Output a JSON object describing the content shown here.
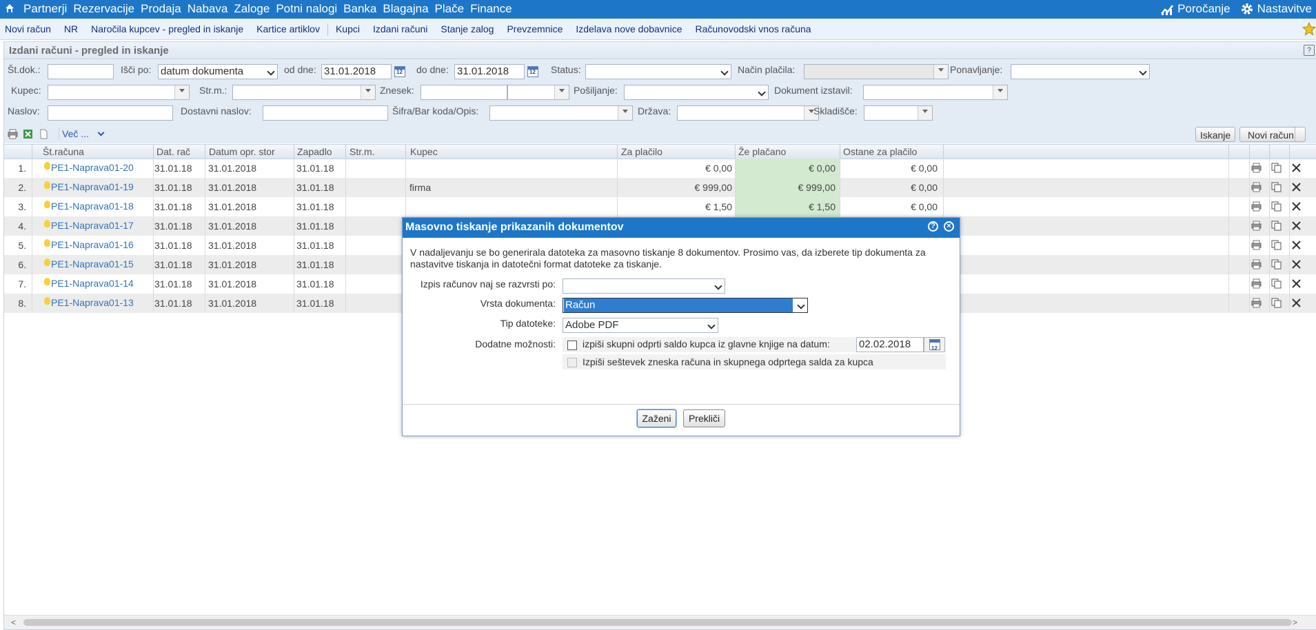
{
  "top_menu": {
    "items": [
      "Partnerji",
      "Rezervacije",
      "Prodaja",
      "Nabava",
      "Zaloge",
      "Potni nalogi",
      "Banka",
      "Blagajna",
      "Plače",
      "Finance"
    ],
    "reports_label": "Poročanje",
    "settings_label": "Nastavitve"
  },
  "sub_menu": {
    "items": [
      "Novi račun",
      "NR",
      "Naročila kupcev - pregled in iskanje",
      "Kartice artiklov",
      "Kupci",
      "Izdani računi",
      "Stanje zalog",
      "Prevzemnice",
      "Izdelava nove dobavnice",
      "Računovodski vnos računa"
    ]
  },
  "panel": {
    "title": "Izdani računi - pregled in iskanje",
    "help_label": "?"
  },
  "filters": {
    "st_dok_label": "Št.dok.:",
    "isci_po_label": "Išči po:",
    "isci_po_value": "datum dokumenta",
    "od_dne_label": "od dne:",
    "od_dne_value": "31.01.2018",
    "do_dne_label": "do dne:",
    "do_dne_value": "31.01.2018",
    "status_label": "Status:",
    "nacin_placila_label": "Način plačila:",
    "ponavljanje_label": "Ponavljanje:",
    "kupec_label": "Kupec:",
    "strm_label": "Str.m.:",
    "znesek_label": "Znesek:",
    "posiljanje_label": "Pošiljanje:",
    "dokument_izstavil_label": "Dokument izstavil:",
    "naslov_label": "Naslov:",
    "dostavni_naslov_label": "Dostavni naslov:",
    "sifra_label": "Šifra/Bar koda/Opis:",
    "drzava_label": "Država:",
    "skladisce_label": "Skladišče:"
  },
  "toolbar": {
    "vec_label": "Več ...",
    "search_button": "Iskanje",
    "new_invoice_button": "Novi račun"
  },
  "grid": {
    "columns": [
      "Št.računa",
      "Dat. rač",
      "Datum opr. stor",
      "Zapadlo",
      "Str.m.",
      "Kupec",
      "Za plačilo",
      "Že plačano",
      "Ostane za plačilo"
    ],
    "rows": [
      {
        "n": "1.",
        "st": "PE1-Naprava01-20",
        "dat": "31.01.18",
        "opr": "31.01.2018",
        "zap": "31.01.18",
        "kupec": "",
        "za": "€ 0,00",
        "ze": "€ 0,00",
        "ost": "€ 0,00"
      },
      {
        "n": "2.",
        "st": "PE1-Naprava01-19",
        "dat": "31.01.18",
        "opr": "31.01.2018",
        "zap": "31.01.18",
        "kupec": "firma",
        "za": "€ 999,00",
        "ze": "€ 999,00",
        "ost": "€ 0,00"
      },
      {
        "n": "3.",
        "st": "PE1-Naprava01-18",
        "dat": "31.01.18",
        "opr": "31.01.2018",
        "zap": "31.01.18",
        "kupec": "",
        "za": "€ 1,50",
        "ze": "€ 1,50",
        "ost": "€ 0,00"
      },
      {
        "n": "4.",
        "st": "PE1-Naprava01-17",
        "dat": "31.01.18",
        "opr": "31.01.2018",
        "zap": "31.01.18",
        "kupec": "",
        "za": "",
        "ze": "",
        "ost": ""
      },
      {
        "n": "5.",
        "st": "PE1-Naprava01-16",
        "dat": "31.01.18",
        "opr": "31.01.2018",
        "zap": "31.01.18",
        "kupec": "",
        "za": "",
        "ze": "",
        "ost": ""
      },
      {
        "n": "6.",
        "st": "PE1-Naprava01-15",
        "dat": "31.01.18",
        "opr": "31.01.2018",
        "zap": "31.01.18",
        "kupec": "",
        "za": "",
        "ze": "",
        "ost": ""
      },
      {
        "n": "7.",
        "st": "PE1-Naprava01-14",
        "dat": "31.01.18",
        "opr": "31.01.2018",
        "zap": "31.01.18",
        "kupec": "",
        "za": "",
        "ze": "",
        "ost": ""
      },
      {
        "n": "8.",
        "st": "PE1-Naprava01-13",
        "dat": "31.01.18",
        "opr": "31.01.2018",
        "zap": "31.01.18",
        "kupec": "",
        "za": "",
        "ze": "",
        "ost": ""
      }
    ]
  },
  "dialog": {
    "title": "Masovno tiskanje prikazanih dokumentov",
    "help_label": "?",
    "close_label": "×",
    "description": "V nadaljevanju se bo generirala datoteka za masovno tiskanje 8 dokumentov. Prosimo vas, da izberete tip dokumenta za nastavitve tiskanja in datotečni format datoteke za tiskanje.",
    "sort_label": "Izpis računov naj se razvrsti po:",
    "sort_value": "",
    "doc_type_label": "Vrsta dokumenta:",
    "doc_type_value": "Račun",
    "file_type_label": "Tip datoteke:",
    "file_type_value": "Adobe PDF",
    "extra_label": "Dodatne možnosti:",
    "option1_label": "izpiši skupni odprti saldo kupca iz glavne knjige na datum:",
    "option1_date": "02.02.2018",
    "option2_label": "Izpiši seštevek zneska računa in skupnega odprtega salda za kupca",
    "run_button": "Zaženi",
    "cancel_button": "Prekliči"
  },
  "colors": {
    "header_blue": "#1e76c8",
    "paid_green": "#d3ead0",
    "link_blue": "#3473bd"
  }
}
